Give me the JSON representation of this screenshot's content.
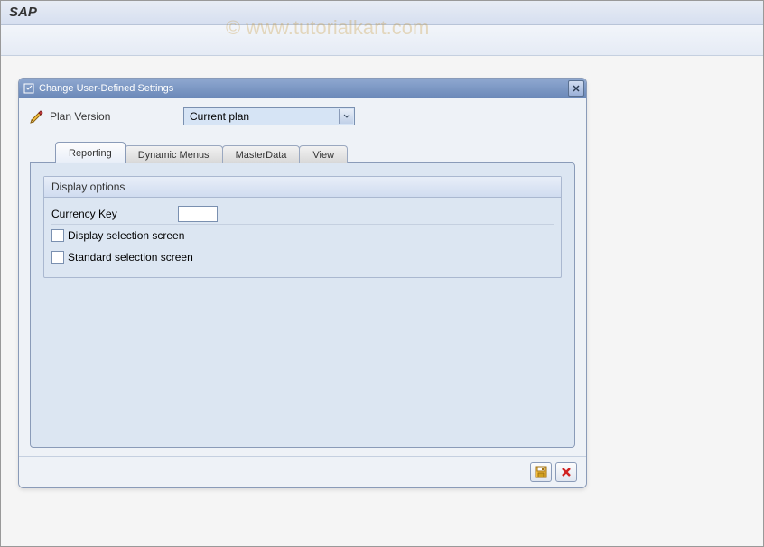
{
  "title_bar": {
    "title": "SAP"
  },
  "watermark": "© www.tutorialkart.com",
  "dialog": {
    "title": "Change User-Defined Settings",
    "plan_version": {
      "label": "Plan Version",
      "value": "Current plan"
    },
    "tabs": [
      {
        "label": "Reporting",
        "active": true
      },
      {
        "label": "Dynamic Menus",
        "active": false
      },
      {
        "label": "MasterData",
        "active": false
      },
      {
        "label": "View",
        "active": false
      }
    ],
    "display_options": {
      "group_title": "Display options",
      "currency_key": {
        "label": "Currency Key",
        "value": ""
      },
      "display_selection": {
        "label": "Display selection screen",
        "checked": false
      },
      "standard_selection": {
        "label": "Standard selection screen",
        "checked": false
      }
    }
  }
}
